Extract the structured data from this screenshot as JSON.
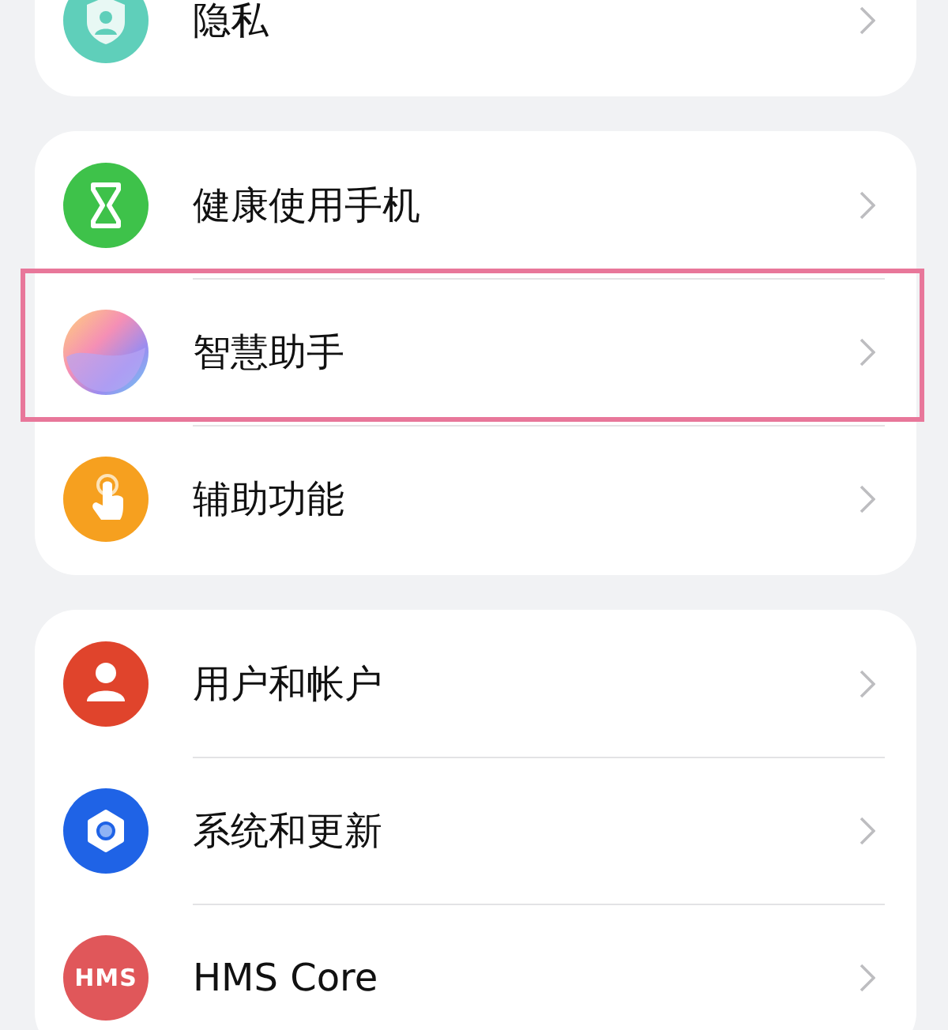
{
  "groups": [
    {
      "items": [
        {
          "label": "隐私",
          "kind": "privacy",
          "selected": false
        }
      ]
    },
    {
      "items": [
        {
          "label": "健康使用手机",
          "kind": "hourglass",
          "selected": false
        },
        {
          "label": "智慧助手",
          "kind": "assistant",
          "selected": true
        },
        {
          "label": "辅助功能",
          "kind": "accessibility",
          "selected": false
        }
      ]
    },
    {
      "items": [
        {
          "label": "用户和帐户",
          "kind": "user",
          "selected": false
        },
        {
          "label": "系统和更新",
          "kind": "system",
          "selected": false
        },
        {
          "label": "HMS Core",
          "kind": "badge",
          "badge_text": "HMS",
          "selected": false
        }
      ]
    }
  ]
}
